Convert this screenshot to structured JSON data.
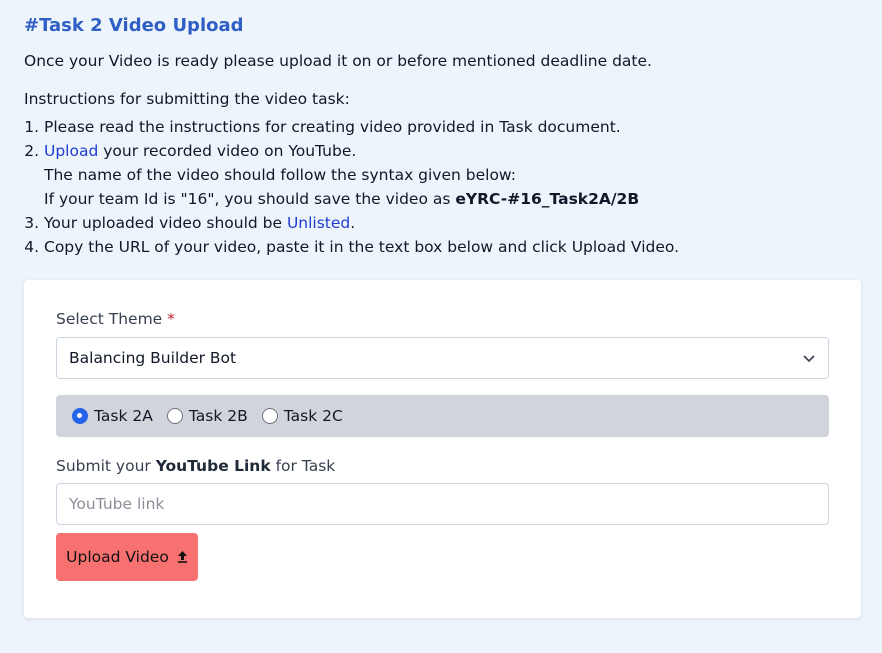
{
  "header": {
    "title": "#Task 2 Video Upload",
    "intro": "Once your Video is ready please upload it on or before mentioned deadline date.",
    "instructions_heading": "Instructions for submitting the video task:"
  },
  "instructions": {
    "item1": "Please read the instructions for creating video provided in Task document.",
    "item2_link": "Upload",
    "item2_text": " your recorded video on YouTube.",
    "item2_line2": "The name of the video should follow the syntax given below:",
    "item2_line3_pre": "If your team Id is \"16\", you should save the video as ",
    "item2_line3_bold": "eYRC-#16_Task2A/2B",
    "item3_pre": "Your uploaded video should be ",
    "item3_link": "Unlisted",
    "item3_post": ".",
    "item4": "Copy the URL of your video, paste it in the text box below and click Upload Video."
  },
  "form": {
    "theme_label": "Select Theme",
    "required_mark": "*",
    "theme_value": "Balancing Builder Bot",
    "tasks": [
      {
        "label": "Task 2A",
        "selected": true
      },
      {
        "label": "Task 2B",
        "selected": false
      },
      {
        "label": "Task 2C",
        "selected": false
      }
    ],
    "submit_label_pre": "Submit your ",
    "submit_label_bold": "YouTube Link",
    "submit_label_post": " for Task",
    "link_placeholder": "YouTube link",
    "link_value": "",
    "upload_button": "Upload Video",
    "upload_icon": "upload-arrow-icon"
  },
  "colors": {
    "title": "#2f5fc4",
    "link": "#1d3ccf",
    "button": "#f87171",
    "radio_selected": "#2563eb"
  }
}
